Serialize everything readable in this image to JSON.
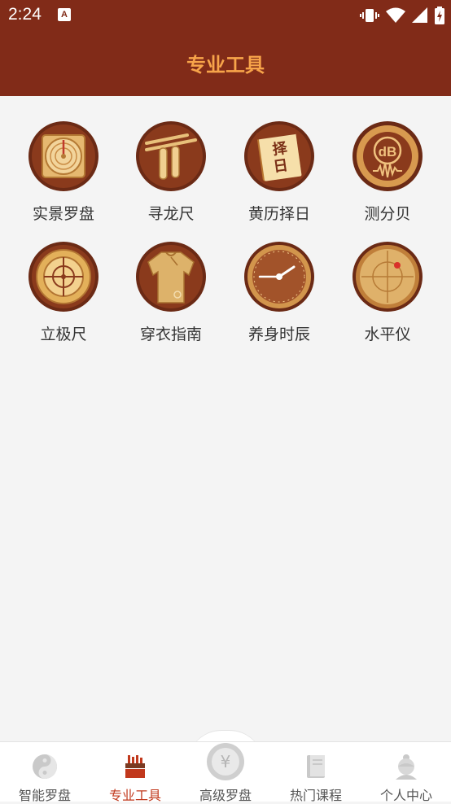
{
  "status": {
    "time": "2:24",
    "notification_glyph": "A"
  },
  "header": {
    "title": "专业工具"
  },
  "tools": [
    {
      "label": "实景罗盘",
      "icon": "compass-real-icon"
    },
    {
      "label": "寻龙尺",
      "icon": "dowsing-rod-icon"
    },
    {
      "label": "黄历择日",
      "icon": "almanac-calendar-icon",
      "badge_text_1": "择",
      "badge_text_2": "日"
    },
    {
      "label": "测分贝",
      "icon": "decibel-meter-icon",
      "badge_text": "dB"
    },
    {
      "label": "立极尺",
      "icon": "geomancy-ruler-icon"
    },
    {
      "label": "穿衣指南",
      "icon": "clothing-guide-icon"
    },
    {
      "label": "养身时辰",
      "icon": "health-clock-icon"
    },
    {
      "label": "水平仪",
      "icon": "spirit-level-icon"
    }
  ],
  "tabs": [
    {
      "label": "智能罗盘",
      "icon": "yin-yang-icon",
      "active": false
    },
    {
      "label": "专业工具",
      "icon": "toolbox-icon",
      "active": true
    },
    {
      "label": "高级罗盘",
      "icon": "coin-yen-icon",
      "active": false,
      "badge_text": "¥"
    },
    {
      "label": "热门课程",
      "icon": "book-icon",
      "active": false
    },
    {
      "label": "个人中心",
      "icon": "person-icon",
      "active": false
    }
  ],
  "colors": {
    "header_bg": "#812b18",
    "title": "#f7a44a",
    "tab_active": "#c1381c"
  }
}
